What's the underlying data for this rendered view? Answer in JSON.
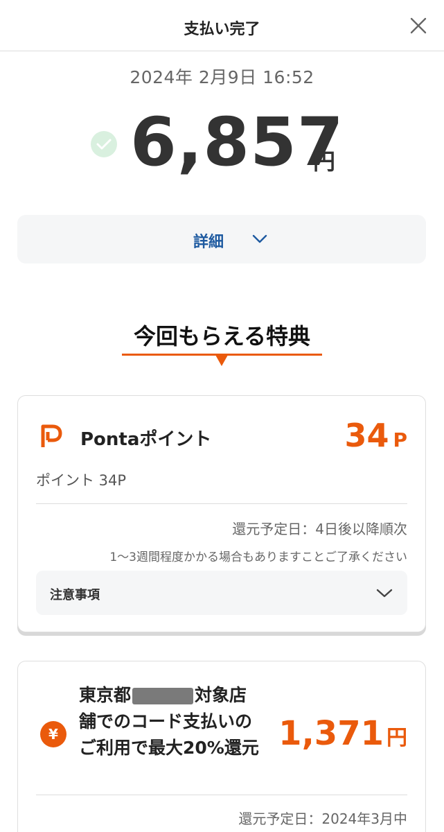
{
  "header": {
    "title": "支払い完了",
    "close_icon": "close-icon"
  },
  "payment": {
    "datetime": "2024年 2月9日 16:52",
    "amount": "6,857",
    "currency_unit": "円",
    "status_icon": "check-circle-icon"
  },
  "details": {
    "label": "詳細",
    "icon": "chevron-down-icon"
  },
  "benefits": {
    "title": "今回もらえる特典",
    "ponta": {
      "icon": "ponta-icon",
      "name": "Pontaポイント",
      "points": "34",
      "points_unit": "P",
      "detail": "ポイント 34P",
      "return_date": "還元予定日：4日後以降順次",
      "note": "1〜3週間程度かかる場合もありますことご了承ください",
      "notice_label": "注意事項",
      "notice_icon": "chevron-down-icon"
    },
    "campaign": {
      "icon": "yen-icon",
      "text_part1": "東京都",
      "text_part2": "対象店舗でのコード支払いのご利用で最大20%還元",
      "amount": "1,371",
      "amount_unit": "円",
      "return_date": "還元予定日：2024年3月中"
    }
  },
  "colors": {
    "accent": "#ea5a0c",
    "link": "#1e5aa0",
    "check": "#d9f0df"
  }
}
